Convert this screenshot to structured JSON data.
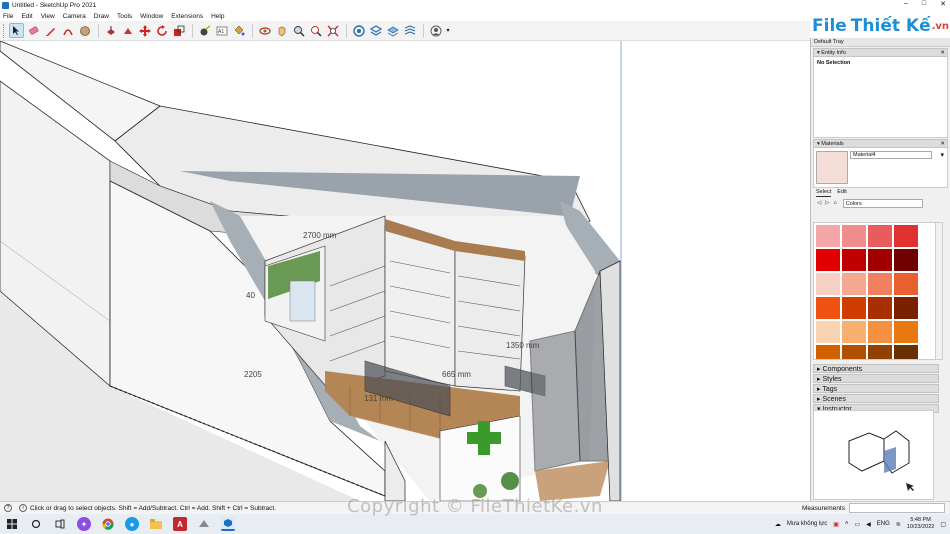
{
  "window": {
    "title": "Untitled - SketchUp Pro 2021",
    "controls": [
      "–",
      "□",
      "✕"
    ]
  },
  "menu": [
    "File",
    "Edit",
    "View",
    "Camera",
    "Draw",
    "Tools",
    "Window",
    "Extensions",
    "Help"
  ],
  "toolbar": {
    "tools": [
      "select-tool",
      "eraser-tool",
      "line-tool",
      "arc-tool",
      "shape-tool",
      "push-pull-tool",
      "move-tool",
      "rotate-tool",
      "scale-tool",
      "offset-tool",
      "tape-measure-tool",
      "text-tool",
      "paint-bucket-tool",
      "orbit-tool",
      "pan-tool",
      "zoom-tool",
      "zoom-extents-tool",
      "3d-warehouse",
      "extension-warehouse",
      "layout",
      "extension-manager",
      "account"
    ]
  },
  "logo": {
    "part1": "File",
    "part2": "Thiết Kế",
    "suffix": ".vn"
  },
  "model_dims": [
    "2700 mm",
    "2205",
    "40",
    "1350 mm",
    "665 mm",
    "131 mm"
  ],
  "tray": {
    "title": "Default Tray",
    "entity_info": {
      "header": "Entity Info",
      "selection": "No Selection"
    },
    "materials": {
      "header": "Materials",
      "material_name": "Material4",
      "tabs": [
        "Select",
        "Edit"
      ],
      "collection": "Colors",
      "swatches": [
        "#f4a6a6",
        "#f08c8c",
        "#e85c5c",
        "#e03030",
        "#e00000",
        "#c00000",
        "#a00000",
        "#700000",
        "#f7d0c4",
        "#f5a890",
        "#f08060",
        "#e86030",
        "#f05010",
        "#d03c00",
        "#a83000",
        "#782000",
        "#fad4b0",
        "#f8b070",
        "#f49040",
        "#e87810",
        "#d06000",
        "#b05000",
        "#904000",
        "#683000"
      ]
    },
    "collapsed_panels": [
      "Components",
      "Styles",
      "Tags",
      "Scenes",
      "Instructor"
    ]
  },
  "status": {
    "hint": "Click or drag to select objects. Shift = Add/Subtract. Ctrl = Add. Shift + Ctrl = Subtract.",
    "measurements_label": "Measurements"
  },
  "taskbar": {
    "weather": "Mưa không lực",
    "lang": "ENG",
    "time": "5:48 PM",
    "date": "10/23/2022"
  },
  "watermark": "Copyright © FileThietKe.vn"
}
